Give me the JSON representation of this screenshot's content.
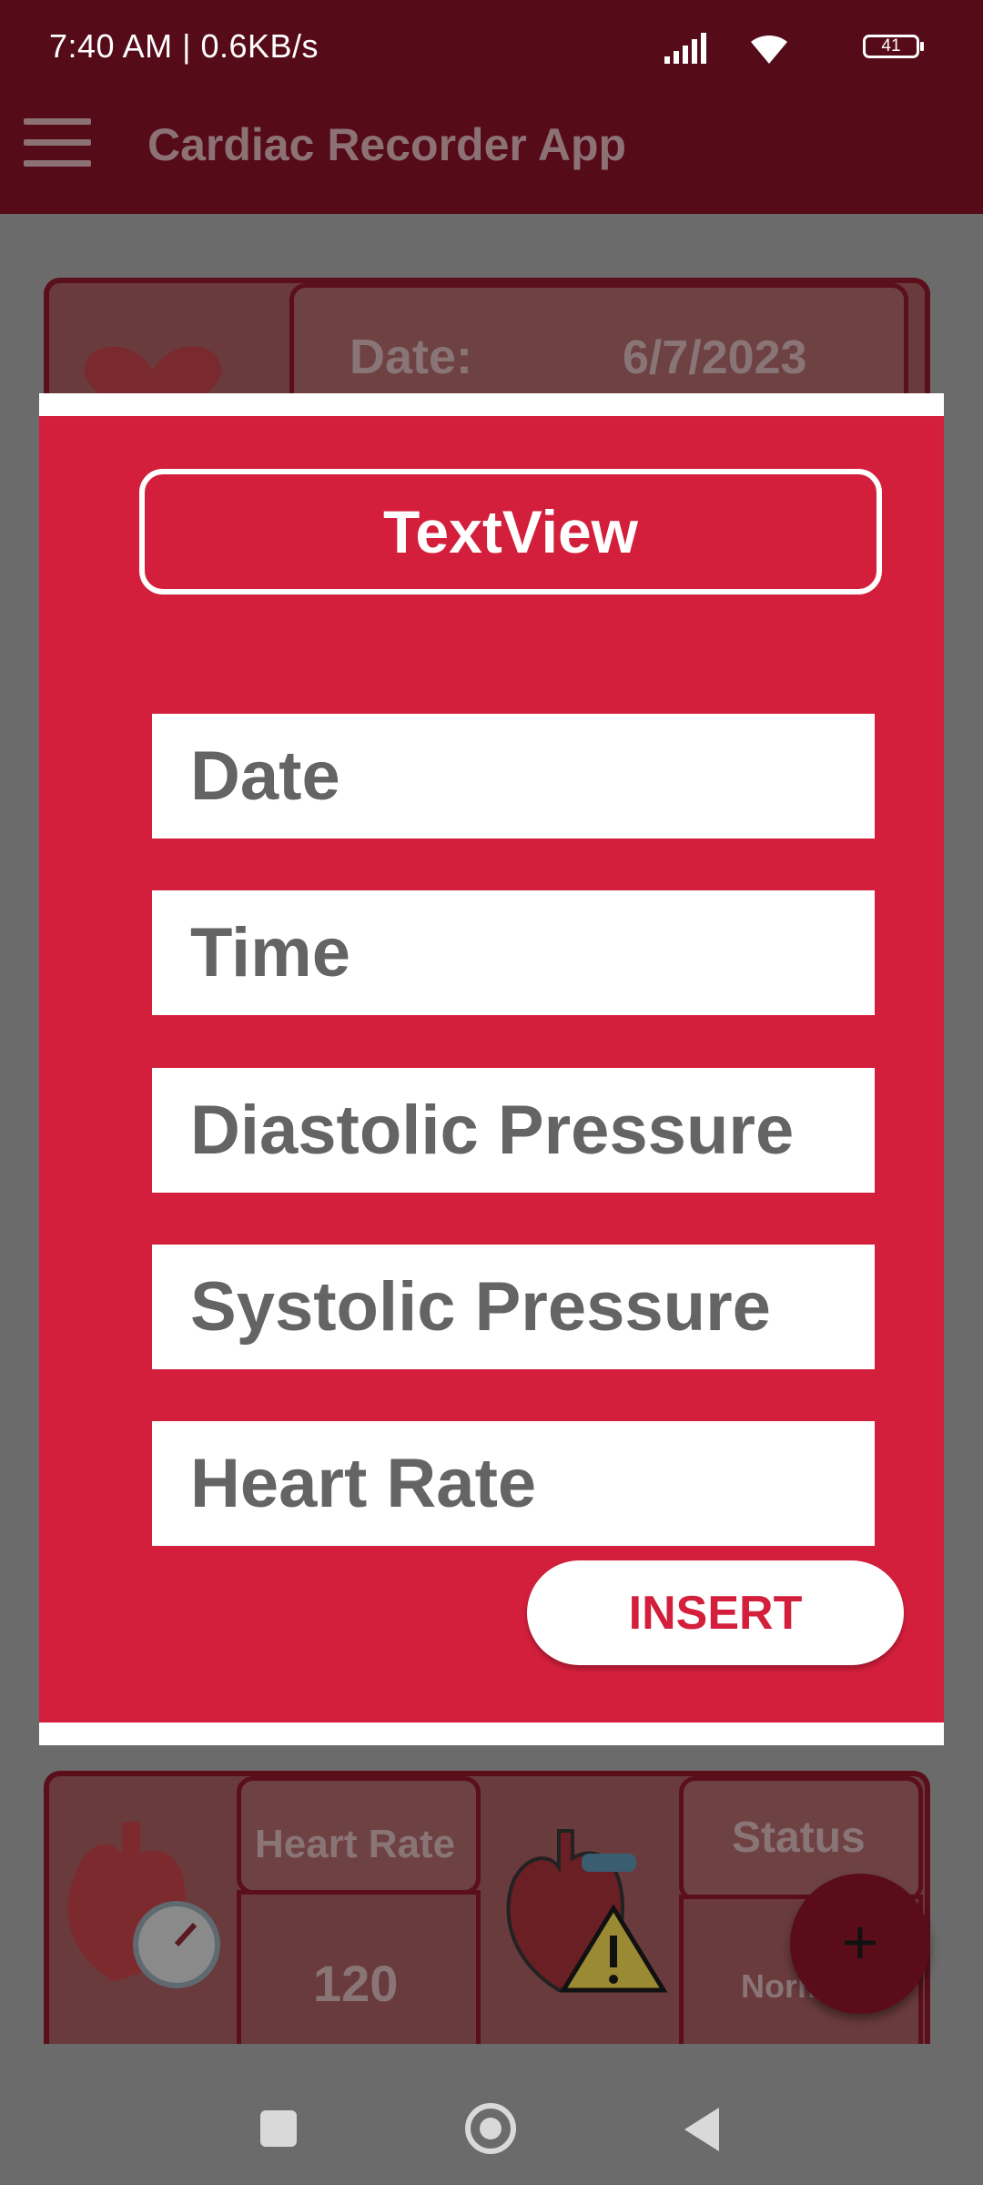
{
  "status_bar": {
    "time_speed": "7:40 AM | 0.6KB/s",
    "battery": "41"
  },
  "app_bar": {
    "title": "Cardiac Recorder App"
  },
  "background_card_top": {
    "date_label": "Date:",
    "date_value": "6/7/2023"
  },
  "background_card_bottom": {
    "heart_rate_label": "Heart Rate",
    "heart_rate_value": "120",
    "status_label": "Status",
    "status_value": "Norm"
  },
  "dialog": {
    "title": "TextView",
    "fields": {
      "date_placeholder": "Date",
      "time_placeholder": "Time",
      "diastolic_placeholder": "Diastolic Pressure",
      "systolic_placeholder": "Systolic Pressure",
      "heart_rate_placeholder": "Heart Rate"
    },
    "insert_label": "INSERT"
  },
  "fab": {
    "label": "+"
  },
  "colors": {
    "primary": "#d31f3c",
    "primary_dark": "#550b18",
    "field_text": "#646464"
  }
}
